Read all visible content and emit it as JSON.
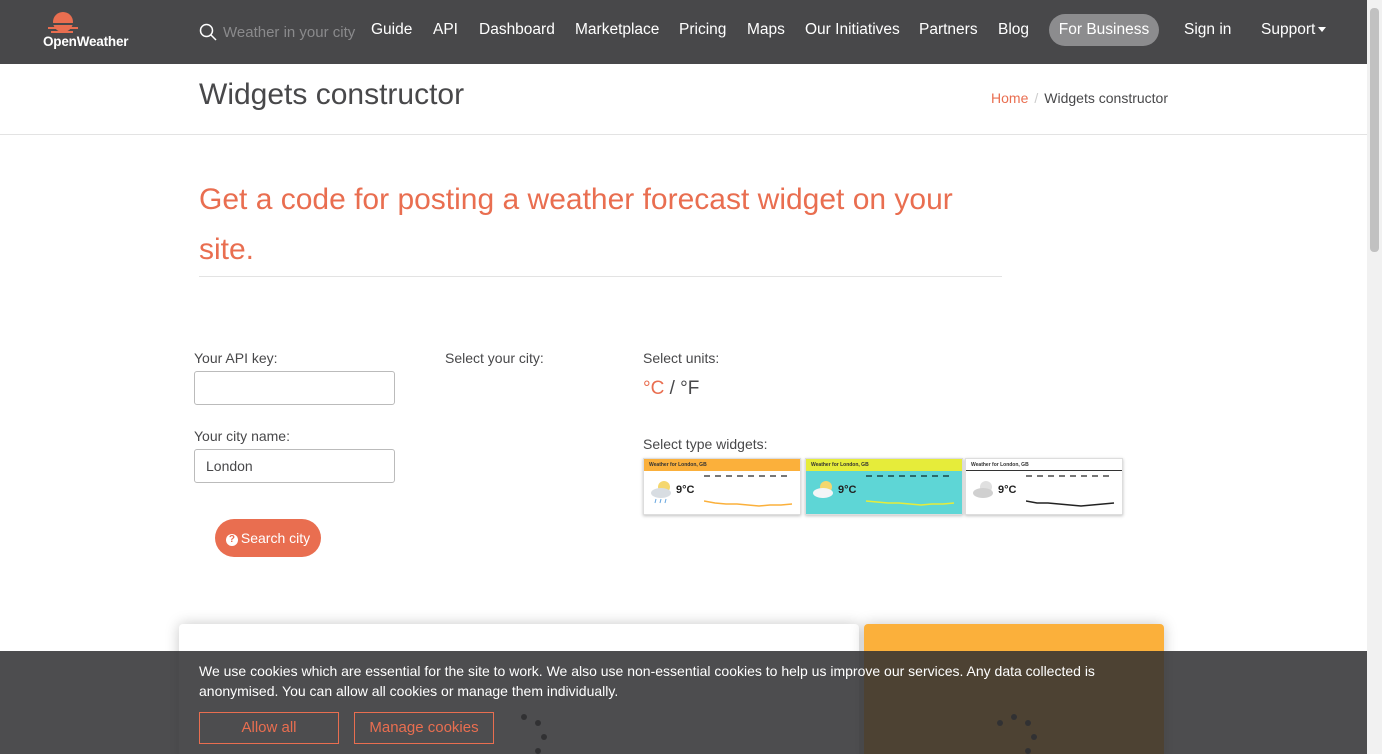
{
  "brand": {
    "name": "OpenWeather",
    "accent": "#e96e50",
    "nav_bg": "#48484a"
  },
  "nav": {
    "search_placeholder": "Weather in your city",
    "items": [
      "Guide",
      "API",
      "Dashboard",
      "Marketplace",
      "Pricing",
      "Maps",
      "Our Initiatives",
      "Partners",
      "Blog"
    ],
    "business": "For Business",
    "signin": "Sign in",
    "support": "Support"
  },
  "page": {
    "title": "Widgets constructor",
    "breadcrumb": {
      "home": "Home",
      "current": "Widgets constructor"
    },
    "headline": "Get a code for posting a weather forecast widget on your site."
  },
  "form": {
    "api_key_label": "Your API key:",
    "api_key_value": "",
    "city_label": "Your city name:",
    "city_value": "London",
    "select_city_label": "Select your city:",
    "units_label": "Select units:",
    "unit_c": "°C",
    "unit_sep": "/",
    "unit_f": "°F",
    "widget_type_label": "Select type widgets:",
    "search_button": "Search city"
  },
  "widgets": [
    {
      "title": "Weather for London, GB",
      "temp": "9°C",
      "bar_color": "#fbb03b",
      "body_color": "#ffffff"
    },
    {
      "title": "Weather for London, GB",
      "temp": "9°C",
      "bar_color": "#e6ec3a",
      "body_color": "#5ed6d6"
    },
    {
      "title": "Weather for London, GB",
      "temp": "9°C",
      "bar_color": "#ffffff",
      "body_color": "#ffffff"
    }
  ],
  "cookie": {
    "text": "We use cookies which are essential for the site to work. We also use non-essential cookies to help us improve our services. Any data collected is anonymised. You can allow all cookies or manage them individually.",
    "allow_all": "Allow all",
    "manage": "Manage cookies"
  }
}
